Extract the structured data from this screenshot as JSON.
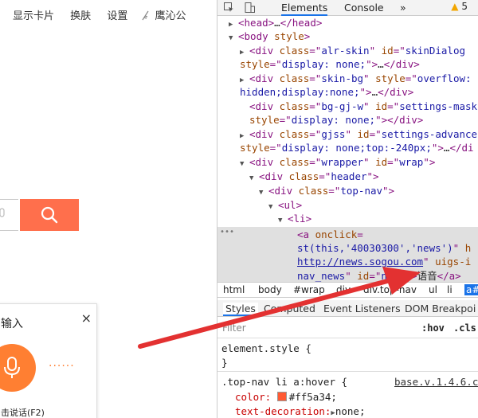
{
  "left": {
    "nav": [
      "显示卡片",
      "换肤",
      "设置",
      "鹰沁公"
    ],
    "voice": {
      "title": "输入",
      "close": "×",
      "dots": "······",
      "hint": "击说话(F2)"
    }
  },
  "devtools": {
    "tabs": [
      "Elements",
      "Console",
      "»"
    ],
    "warning_count": "5",
    "lines": [
      {
        "seg": [
          [
            "tag",
            "<head>"
          ],
          [
            "txt",
            "…"
          ],
          [
            "tag",
            "</head>"
          ]
        ]
      },
      {
        "seg": [
          [
            "tag",
            "<body "
          ],
          [
            "attr",
            "style"
          ],
          [
            "tag",
            ">"
          ]
        ]
      },
      {
        "seg": [
          [
            "tag",
            "<div "
          ],
          [
            "attr",
            "class"
          ],
          [
            "tag",
            "=\""
          ],
          [
            "val",
            "alr-skin"
          ],
          [
            "tag",
            "\" "
          ],
          [
            "attr",
            "id"
          ],
          [
            "tag",
            "=\""
          ],
          [
            "val",
            "skinDialog"
          ]
        ]
      },
      {
        "seg": [
          [
            "attr",
            "style"
          ],
          [
            "tag",
            "=\""
          ],
          [
            "val",
            "display: none;"
          ],
          [
            "tag",
            "\">"
          ],
          [
            "txt",
            "…"
          ],
          [
            "tag",
            "</div>"
          ]
        ]
      },
      {
        "seg": [
          [
            "tag",
            "<div "
          ],
          [
            "attr",
            "class"
          ],
          [
            "tag",
            "=\""
          ],
          [
            "val",
            "skin-bg"
          ],
          [
            "tag",
            "\" "
          ],
          [
            "attr",
            "style"
          ],
          [
            "tag",
            "=\""
          ],
          [
            "val",
            "overflow:"
          ]
        ]
      },
      {
        "seg": [
          [
            "val",
            "hidden;display:none;"
          ],
          [
            "tag",
            "\">"
          ],
          [
            "txt",
            "…"
          ],
          [
            "tag",
            "</div>"
          ]
        ]
      },
      {
        "seg": [
          [
            "tag",
            "<div "
          ],
          [
            "attr",
            "class"
          ],
          [
            "tag",
            "=\""
          ],
          [
            "val",
            "bg-gj-w"
          ],
          [
            "tag",
            "\" "
          ],
          [
            "attr",
            "id"
          ],
          [
            "tag",
            "=\""
          ],
          [
            "val",
            "settings-mask"
          ]
        ]
      },
      {
        "seg": [
          [
            "attr",
            "style"
          ],
          [
            "tag",
            "=\""
          ],
          [
            "val",
            "display: none;"
          ],
          [
            "tag",
            "\"></div>"
          ]
        ]
      },
      {
        "seg": [
          [
            "tag",
            "<div "
          ],
          [
            "attr",
            "class"
          ],
          [
            "tag",
            "=\""
          ],
          [
            "val",
            "gjss"
          ],
          [
            "tag",
            "\" "
          ],
          [
            "attr",
            "id"
          ],
          [
            "tag",
            "=\""
          ],
          [
            "val",
            "settings-advance"
          ]
        ]
      },
      {
        "seg": [
          [
            "attr",
            "style"
          ],
          [
            "tag",
            "=\""
          ],
          [
            "val",
            "display: none;top:-240px;"
          ],
          [
            "tag",
            "\">"
          ],
          [
            "txt",
            "…"
          ],
          [
            "tag",
            "</di"
          ]
        ]
      },
      {
        "seg": [
          [
            "tag",
            "<div "
          ],
          [
            "attr",
            "class"
          ],
          [
            "tag",
            "=\""
          ],
          [
            "val",
            "wrapper"
          ],
          [
            "tag",
            "\" "
          ],
          [
            "attr",
            "id"
          ],
          [
            "tag",
            "=\""
          ],
          [
            "val",
            "wrap"
          ],
          [
            "tag",
            "\">"
          ]
        ]
      },
      {
        "seg": [
          [
            "tag",
            "<div "
          ],
          [
            "attr",
            "class"
          ],
          [
            "tag",
            "=\""
          ],
          [
            "val",
            "header"
          ],
          [
            "tag",
            "\">"
          ]
        ]
      },
      {
        "seg": [
          [
            "tag",
            "<div "
          ],
          [
            "attr",
            "class"
          ],
          [
            "tag",
            "=\""
          ],
          [
            "val",
            "top-nav"
          ],
          [
            "tag",
            "\">"
          ]
        ]
      },
      {
        "seg": [
          [
            "tag",
            "<ul>"
          ]
        ]
      },
      {
        "seg": [
          [
            "tag",
            "<li>"
          ]
        ]
      },
      {
        "seg": [
          [
            "tag",
            "<a "
          ],
          [
            "attr",
            "onclick"
          ],
          [
            "tag",
            "="
          ]
        ]
      },
      {
        "seg": [
          [
            "val",
            "st(this,'40030300','news')"
          ],
          [
            "tag",
            "\" "
          ],
          [
            "attr",
            "h"
          ]
        ]
      },
      {
        "seg": [
          [
            "val",
            "http://news.sogou.com"
          ],
          [
            "tag",
            "\" "
          ],
          [
            "attr",
            "uigs-i"
          ]
        ]
      },
      {
        "seg": [
          [
            "val",
            "nav_news"
          ],
          [
            "tag",
            "\" "
          ],
          [
            "attr",
            "id"
          ],
          [
            "tag",
            "=\""
          ],
          [
            "val",
            "news"
          ],
          [
            "tag",
            "\">"
          ],
          [
            "txt",
            "语音"
          ],
          [
            "tag",
            "</a>"
          ]
        ]
      }
    ],
    "breadcrumbs": [
      "html",
      "body",
      "#wrap",
      "div",
      "div.top-nav",
      "ul",
      "li",
      "a#"
    ],
    "pane_tabs": [
      "Styles",
      "Computed",
      "Event Listeners",
      "DOM Breakpoi"
    ],
    "filter_placeholder": "Filter",
    "hov": ":hov",
    "cls": ".cls",
    "element_style": "element.style {",
    "close_brace": "}",
    "rule_selector": ".top-nav li a:hover {",
    "rule_source": "base.v.1.4.6.c",
    "prop_color": "color:",
    "prop_color_val": "#ff5a34;",
    "prop_td": "text-decoration:",
    "prop_td_val": "none;"
  }
}
